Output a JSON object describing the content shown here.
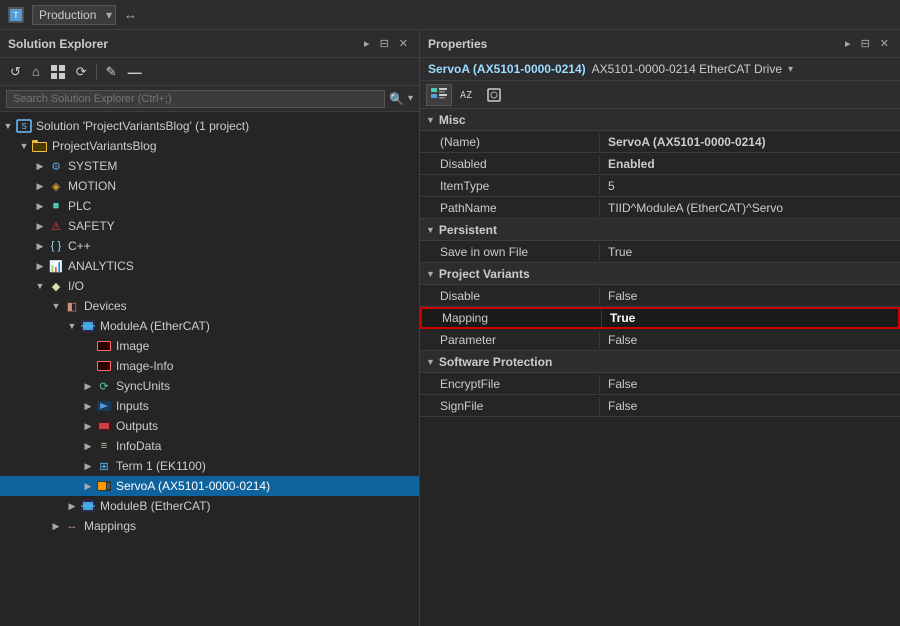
{
  "titleBar": {
    "icon": "⚙",
    "text": "Production",
    "dropdownLabel": "Production",
    "extraIcon": "↔"
  },
  "solutionExplorer": {
    "title": "Solution Explorer",
    "searchPlaceholder": "Search Solution Explorer (Ctrl+;)",
    "toolbar": {
      "buttons": [
        "↺",
        "⌂",
        "⊞",
        "↺",
        "✎",
        "—"
      ]
    },
    "tree": [
      {
        "id": "solution",
        "indent": 0,
        "expand": "▼",
        "icon": "solution",
        "label": "Solution 'ProjectVariantsBlog' (1 project)"
      },
      {
        "id": "project",
        "indent": 1,
        "expand": "▼",
        "icon": "project",
        "label": "ProjectVariantsBlog"
      },
      {
        "id": "system",
        "indent": 2,
        "expand": "▶",
        "icon": "system",
        "label": "SYSTEM"
      },
      {
        "id": "motion",
        "indent": 2,
        "expand": "▶",
        "icon": "motion",
        "label": "MOTION"
      },
      {
        "id": "plc",
        "indent": 2,
        "expand": "▶",
        "icon": "plc",
        "label": "PLC"
      },
      {
        "id": "safety",
        "indent": 2,
        "expand": "▶",
        "icon": "safety",
        "label": "SAFETY"
      },
      {
        "id": "cpp",
        "indent": 2,
        "expand": "▶",
        "icon": "cpp",
        "label": "C++"
      },
      {
        "id": "analytics",
        "indent": 2,
        "expand": "▶",
        "icon": "analytics",
        "label": "ANALYTICS"
      },
      {
        "id": "io",
        "indent": 2,
        "expand": "▼",
        "icon": "io",
        "label": "I/O"
      },
      {
        "id": "devices",
        "indent": 3,
        "expand": "▼",
        "icon": "devices",
        "label": "Devices"
      },
      {
        "id": "modulea",
        "indent": 4,
        "expand": "▼",
        "icon": "ethercat",
        "label": "ModuleA (EtherCAT)"
      },
      {
        "id": "image",
        "indent": 5,
        "expand": "",
        "icon": "image",
        "label": "Image"
      },
      {
        "id": "imageinfo",
        "indent": 5,
        "expand": "",
        "icon": "image",
        "label": "Image-Info"
      },
      {
        "id": "syncunits",
        "indent": 5,
        "expand": "▶",
        "icon": "sync",
        "label": "SyncUnits"
      },
      {
        "id": "inputs",
        "indent": 5,
        "expand": "▶",
        "icon": "inputs",
        "label": "Inputs"
      },
      {
        "id": "outputs",
        "indent": 5,
        "expand": "▶",
        "icon": "outputs",
        "label": "Outputs"
      },
      {
        "id": "infodata",
        "indent": 5,
        "expand": "▶",
        "icon": "infodata",
        "label": "InfoData"
      },
      {
        "id": "term1",
        "indent": 5,
        "expand": "▶",
        "icon": "term",
        "label": "Term 1 (EK1100)"
      },
      {
        "id": "servoa",
        "indent": 5,
        "expand": "▶",
        "icon": "servo",
        "label": "ServoA (AX5101-0000-0214)",
        "selected": true
      },
      {
        "id": "moduleb",
        "indent": 4,
        "expand": "▶",
        "icon": "ethercat",
        "label": "ModuleB (EtherCAT)"
      },
      {
        "id": "mappings",
        "indent": 3,
        "expand": "▶",
        "icon": "mappings",
        "label": "Mappings"
      }
    ]
  },
  "properties": {
    "title": "Properties",
    "objectName": "ServoA (AX5101-0000-0214)",
    "objectType": "AX5101-0000-0214 EtherCAT Drive",
    "sections": [
      {
        "id": "misc",
        "title": "Misc",
        "expanded": true,
        "rows": [
          {
            "name": "(Name)",
            "value": "ServoA (AX5101-0000-0214)",
            "bold": true
          },
          {
            "name": "Disabled",
            "value": "Enabled",
            "bold": true
          },
          {
            "name": "ItemType",
            "value": "5",
            "bold": false
          },
          {
            "name": "PathName",
            "value": "TIID^ModuleA (EtherCAT)^Servo",
            "bold": false,
            "truncated": true
          }
        ]
      },
      {
        "id": "persistent",
        "title": "Persistent",
        "expanded": true,
        "rows": [
          {
            "name": "Save in own File",
            "value": "True",
            "bold": false
          }
        ]
      },
      {
        "id": "projectvariants",
        "title": "Project Variants",
        "expanded": true,
        "rows": [
          {
            "name": "Disable",
            "value": "False",
            "bold": false
          },
          {
            "name": "Mapping",
            "value": "True",
            "bold": true,
            "highlighted": true
          },
          {
            "name": "Parameter",
            "value": "False",
            "bold": false
          }
        ]
      },
      {
        "id": "softwareprotection",
        "title": "Software Protection",
        "expanded": true,
        "rows": [
          {
            "name": "EncryptFile",
            "value": "False",
            "bold": false
          },
          {
            "name": "SignFile",
            "value": "False",
            "bold": false
          }
        ]
      }
    ]
  }
}
